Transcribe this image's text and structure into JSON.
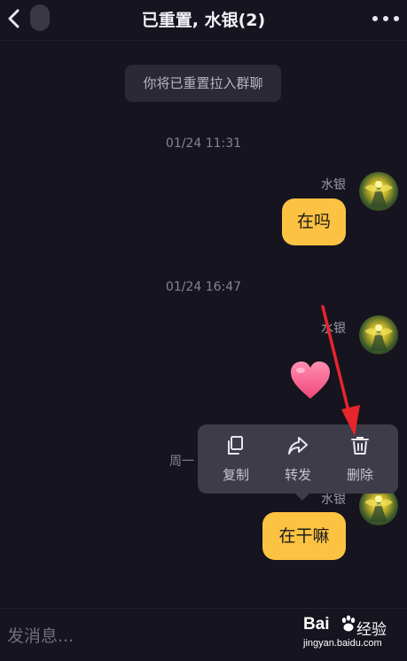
{
  "header": {
    "title": "已重置, 水银(2)"
  },
  "messages": {
    "system_notice": "你将已重置拉入群聊",
    "timestamp_1": "01/24 11:31",
    "sender_1": "水银",
    "bubble_1": "在吗",
    "timestamp_2": "01/24 16:47",
    "sender_2": "水银",
    "timestamp_3_partial": "周一",
    "sender_3": "水银",
    "bubble_3": "在干嘛"
  },
  "context_menu": {
    "copy_label": "复制",
    "forward_label": "转发",
    "delete_label": "删除"
  },
  "input": {
    "placeholder": "发消息..."
  },
  "watermark": {
    "logo_text": "Bai",
    "logo_suffix": "经验",
    "url": "jingyan.baidu.com"
  },
  "colors": {
    "background": "#16141f",
    "bubble": "#fcc242",
    "menu": "#3e3c48",
    "annotation_arrow": "#e8252b"
  },
  "icons": [
    "back-arrow-icon",
    "more-dots-icon",
    "copy-icon",
    "forward-icon",
    "delete-trash-icon",
    "heart-icon",
    "avatar-image"
  ]
}
